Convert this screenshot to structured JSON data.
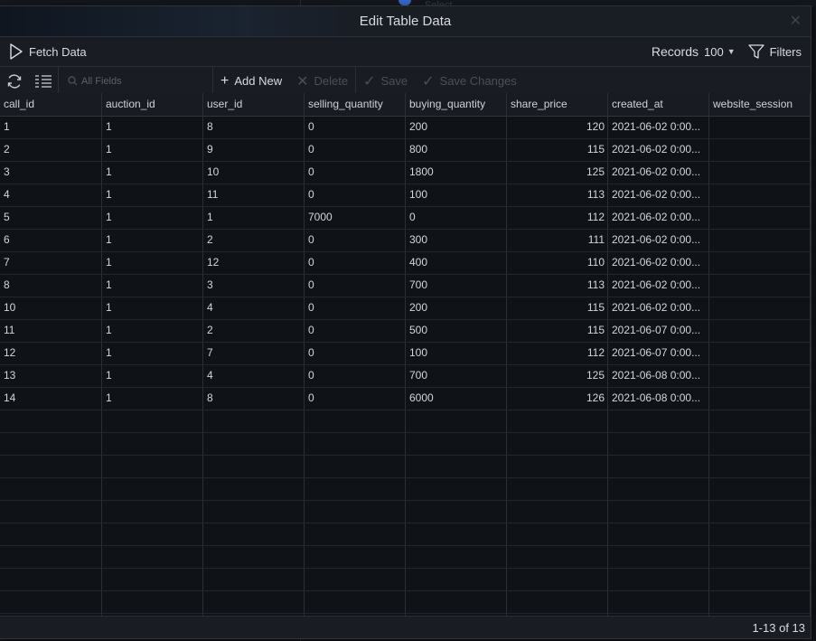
{
  "background": {
    "ghost_label": "Select"
  },
  "dialog": {
    "title": "Edit Table Data",
    "close_glyph": "✕"
  },
  "toolbar": {
    "fetch_label": "Fetch Data",
    "records_label": "Records",
    "records_value": "100",
    "filters_label": "Filters",
    "search_placeholder": "All Fields",
    "add_new_label": "Add New",
    "delete_label": "Delete",
    "save_label": "Save",
    "save_changes_label": "Save Changes"
  },
  "icons": {
    "fetch": "play-icon",
    "refresh": "refresh-icon",
    "columns": "columns-icon",
    "search": "search-icon",
    "filters": "filter-icon",
    "add": "plus-icon",
    "delete": "x-icon",
    "save": "check-icon"
  },
  "table": {
    "columns": [
      "call_id",
      "auction_id",
      "user_id",
      "selling_quantity",
      "buying_quantity",
      "share_price",
      "created_at",
      "website_session"
    ],
    "rows": [
      [
        "1",
        "1",
        "8",
        "0",
        "200",
        "120",
        "2021-06-02 0:00...",
        ""
      ],
      [
        "2",
        "1",
        "9",
        "0",
        "800",
        "115",
        "2021-06-02 0:00...",
        ""
      ],
      [
        "3",
        "1",
        "10",
        "0",
        "1800",
        "125",
        "2021-06-02 0:00...",
        ""
      ],
      [
        "4",
        "1",
        "11",
        "0",
        "100",
        "113",
        "2021-06-02 0:00...",
        ""
      ],
      [
        "5",
        "1",
        "1",
        "7000",
        "0",
        "112",
        "2021-06-02 0:00...",
        ""
      ],
      [
        "6",
        "1",
        "2",
        "0",
        "300",
        "111",
        "2021-06-02 0:00...",
        ""
      ],
      [
        "7",
        "1",
        "12",
        "0",
        "400",
        "110",
        "2021-06-02 0:00...",
        ""
      ],
      [
        "8",
        "1",
        "3",
        "0",
        "700",
        "113",
        "2021-06-02 0:00...",
        ""
      ],
      [
        "10",
        "1",
        "4",
        "0",
        "200",
        "115",
        "2021-06-02 0:00...",
        ""
      ],
      [
        "11",
        "1",
        "2",
        "0",
        "500",
        "115",
        "2021-06-07 0:00...",
        ""
      ],
      [
        "12",
        "1",
        "7",
        "0",
        "100",
        "112",
        "2021-06-07 0:00...",
        ""
      ],
      [
        "13",
        "1",
        "4",
        "0",
        "700",
        "125",
        "2021-06-08 0:00...",
        ""
      ],
      [
        "14",
        "1",
        "8",
        "0",
        "6000",
        "126",
        "2021-06-08 0:00...",
        ""
      ]
    ]
  },
  "status": {
    "range_text": "1-13 of 13"
  },
  "colors": {
    "accent": "#3b6fd8",
    "background": "#111318",
    "text": "#d6d8dc",
    "disabled": "#4a4f58"
  }
}
